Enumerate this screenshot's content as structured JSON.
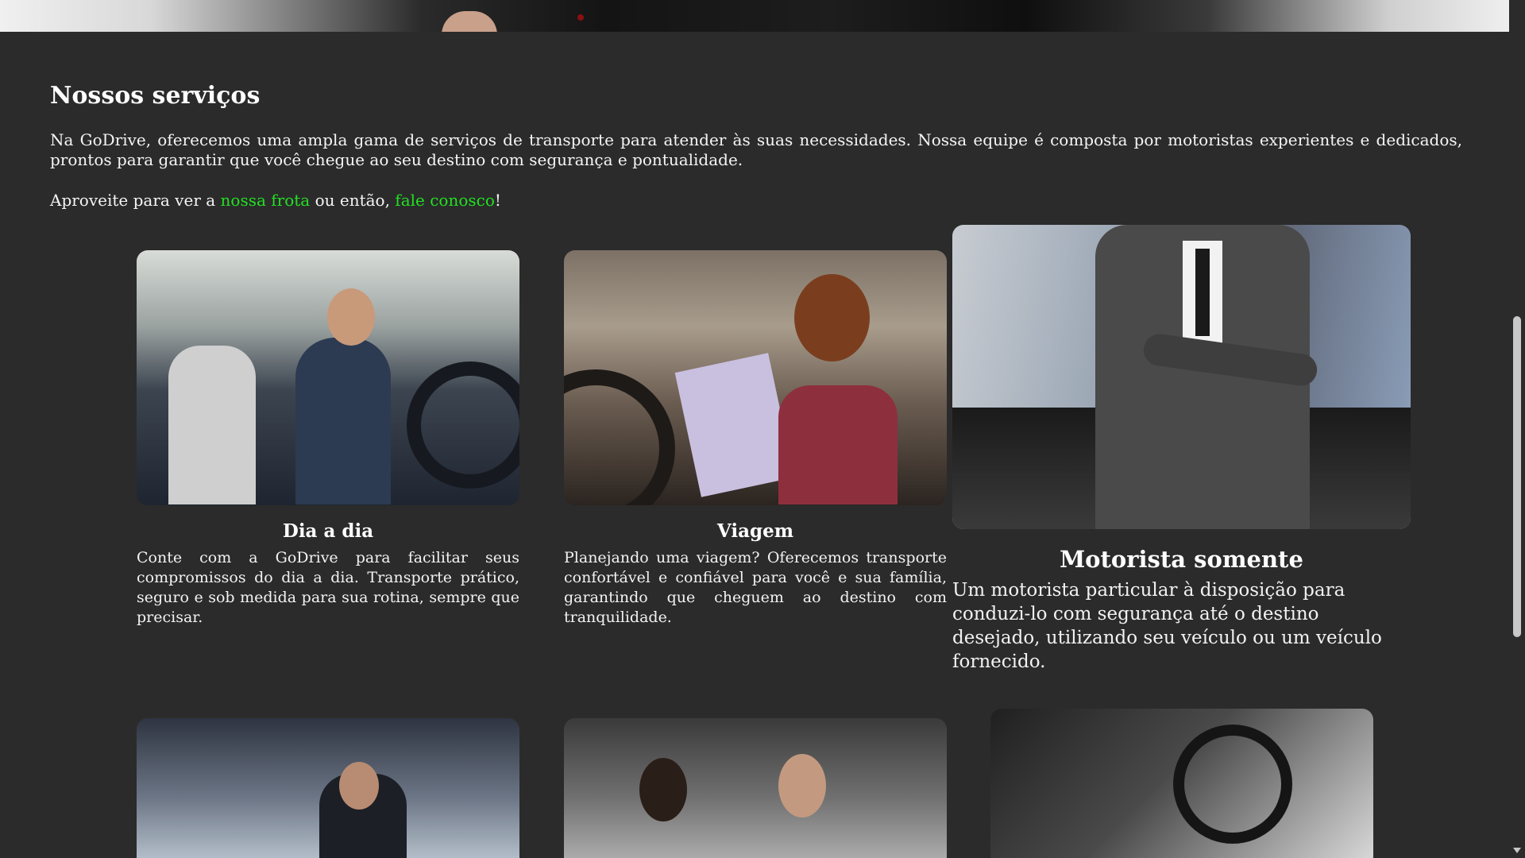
{
  "section": {
    "title": "Nossos serviços",
    "intro": "Na GoDrive, oferecemos uma ampla gama de serviços de transporte para atender às suas necessidades. Nossa equipe é composta por motoristas experientes e dedicados, prontos para garantir que você chegue ao seu destino com segurança e pontualidade.",
    "cta_prefix": "Aproveite para ver a ",
    "cta_link1": "nossa frota",
    "cta_middle": " ou então, ",
    "cta_link2": "fale conosco",
    "cta_suffix": "!"
  },
  "services": [
    {
      "title": "Dia a dia",
      "description": "Conte com a GoDrive para facilitar seus compromissos do dia a dia. Transporte prático, seguro e sob medida para sua rotina, sempre que precisar."
    },
    {
      "title": "Viagem",
      "description": "Planejando uma viagem? Oferecemos transporte confortável e confiável para você e sua família, garantindo que cheguem ao destino com tranquilidade."
    },
    {
      "title": "Motorista somente",
      "description": "Um motorista particular à disposição para conduzi-lo com segurança até o destino desejado, utilizando seu veículo ou um veículo fornecido."
    }
  ],
  "colors": {
    "background": "#2b2b2b",
    "text": "#f2f2f2",
    "link": "#22e022"
  }
}
